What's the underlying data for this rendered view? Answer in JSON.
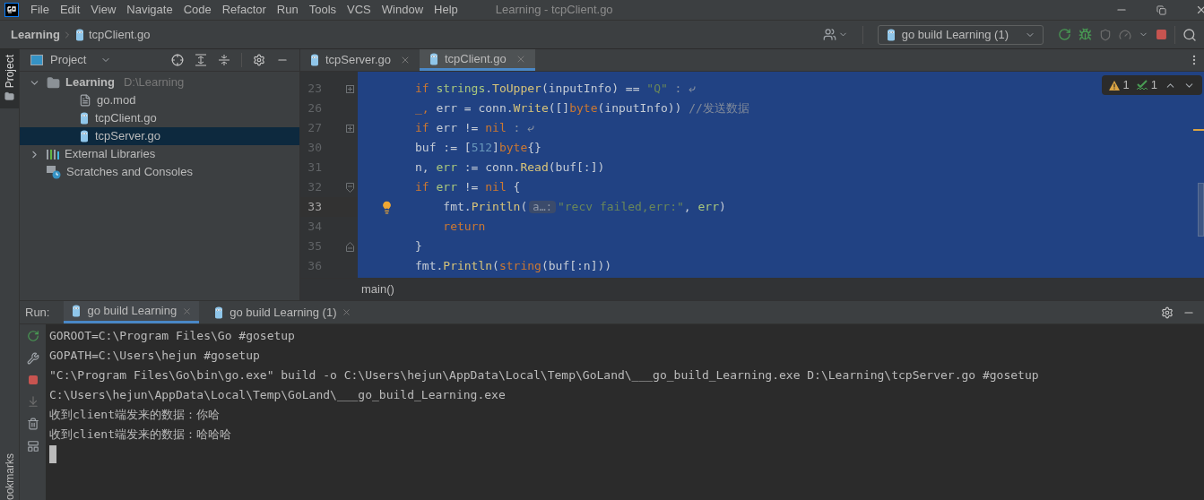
{
  "menu": [
    "File",
    "Edit",
    "View",
    "Navigate",
    "Code",
    "Refactor",
    "Run",
    "Tools",
    "VCS",
    "Window",
    "Help"
  ],
  "window": {
    "title": "Learning - tcpClient.go"
  },
  "breadcrumb": [
    "Learning",
    "tcpClient.go"
  ],
  "run_config": {
    "label": "go build Learning (1)"
  },
  "side_tabs": {
    "top": "Project",
    "bottom": "ookmarks"
  },
  "project": {
    "title": "Project",
    "tree": [
      {
        "label": "Learning",
        "path": "D:\\Learning",
        "kind": "folder",
        "expanded": true,
        "selected": false,
        "children": [
          {
            "label": "go.mod",
            "kind": "text",
            "selected": false
          },
          {
            "label": "tcpClient.go",
            "kind": "go",
            "selected": false
          },
          {
            "label": "tcpServer.go",
            "kind": "go",
            "selected": true
          }
        ]
      },
      {
        "label": "External Libraries",
        "kind": "library",
        "expanded": false,
        "selected": false
      },
      {
        "label": "Scratches and Consoles",
        "kind": "scratch",
        "selected": false
      }
    ]
  },
  "editor_tabs": [
    {
      "label": "tcpServer.go",
      "selected": false
    },
    {
      "label": "tcpClient.go",
      "selected": true
    }
  ],
  "inspections": {
    "warnings": "1",
    "typos": "1"
  },
  "code": [
    {
      "number": "23",
      "kind": "collapsed",
      "current": false,
      "tokens": [
        {
          "text": "if ",
          "kind": "keyword"
        },
        {
          "text": "strings",
          "kind": "ident"
        },
        {
          "text": ".",
          "kind": "plain"
        },
        {
          "text": "ToUpper",
          "kind": "function"
        },
        {
          "text": "(inputInfo) == ",
          "kind": "plain"
        },
        {
          "text": "\"Q\"",
          "kind": "string"
        },
        {
          "text": " : ⤶",
          "kind": "folded"
        }
      ]
    },
    {
      "number": "26",
      "kind": "plain",
      "current": false,
      "tokens": [
        {
          "text": "_, ",
          "kind": "keyword"
        },
        {
          "text": "err = conn.",
          "kind": "plain"
        },
        {
          "text": "Write",
          "kind": "function"
        },
        {
          "text": "([]",
          "kind": "plain"
        },
        {
          "text": "byte",
          "kind": "keyword"
        },
        {
          "text": "(inputInfo)) ",
          "kind": "plain"
        },
        {
          "text": "//发送数据",
          "kind": "comment"
        }
      ]
    },
    {
      "number": "27",
      "kind": "collapsed",
      "current": false,
      "tokens": [
        {
          "text": "if ",
          "kind": "keyword"
        },
        {
          "text": "err != ",
          "kind": "plain"
        },
        {
          "text": "nil",
          "kind": "keyword"
        },
        {
          "text": " : ⤶",
          "kind": "folded"
        }
      ]
    },
    {
      "number": "30",
      "kind": "plain",
      "current": false,
      "tokens": [
        {
          "text": "buf := [",
          "kind": "plain"
        },
        {
          "text": "512",
          "kind": "number"
        },
        {
          "text": "]",
          "kind": "plain"
        },
        {
          "text": "byte",
          "kind": "keyword"
        },
        {
          "text": "{}",
          "kind": "plain"
        }
      ]
    },
    {
      "number": "31",
      "kind": "plain",
      "current": false,
      "tokens": [
        {
          "text": "n, ",
          "kind": "plain"
        },
        {
          "text": "err",
          "kind": "ident"
        },
        {
          "text": " := conn.",
          "kind": "plain"
        },
        {
          "text": "Read",
          "kind": "function"
        },
        {
          "text": "(buf[:])",
          "kind": "plain"
        }
      ]
    },
    {
      "number": "32",
      "kind": "fold_start",
      "current": false,
      "tokens": [
        {
          "text": "if ",
          "kind": "keyword"
        },
        {
          "text": "err",
          "kind": "ident"
        },
        {
          "text": " != ",
          "kind": "plain"
        },
        {
          "text": "nil",
          "kind": "keyword"
        },
        {
          "text": " {",
          "kind": "plain"
        }
      ]
    },
    {
      "number": "33",
      "kind": "plain",
      "current": true,
      "tokens": [
        {
          "text": "    fmt.",
          "kind": "plain"
        },
        {
          "text": "Println",
          "kind": "function"
        },
        {
          "text": "(",
          "kind": "plain"
        },
        {
          "text": "a…:",
          "kind": "hint"
        },
        {
          "text": "\"recv failed,err:\"",
          "kind": "string"
        },
        {
          "text": ", ",
          "kind": "plain"
        },
        {
          "text": "err",
          "kind": "ident"
        },
        {
          "text": ")",
          "kind": "plain"
        }
      ]
    },
    {
      "number": "34",
      "kind": "plain",
      "current": false,
      "tokens": [
        {
          "text": "    return",
          "kind": "keyword"
        }
      ]
    },
    {
      "number": "35",
      "kind": "fold_end",
      "current": false,
      "tokens": [
        {
          "text": "}",
          "kind": "plain"
        }
      ]
    },
    {
      "number": "36",
      "kind": "plain",
      "current": false,
      "tokens": [
        {
          "text": "fmt.",
          "kind": "plain"
        },
        {
          "text": "Println",
          "kind": "function"
        },
        {
          "text": "(",
          "kind": "plain"
        },
        {
          "text": "string",
          "kind": "keyword"
        },
        {
          "text": "(buf[:n]))",
          "kind": "plain"
        }
      ]
    }
  ],
  "editor_breadcrumb": "main()",
  "run": {
    "label": "Run:",
    "tabs": [
      {
        "label": "go build Learning",
        "selected": true
      },
      {
        "label": "go build Learning (1)",
        "selected": false
      }
    ],
    "console": [
      "GOROOT=C:\\Program Files\\Go #gosetup",
      "GOPATH=C:\\Users\\hejun #gosetup",
      "\"C:\\Program Files\\Go\\bin\\go.exe\" build -o C:\\Users\\hejun\\AppData\\Local\\Temp\\GoLand\\___go_build_Learning.exe D:\\Learning\\tcpServer.go #gosetup",
      "C:\\Users\\hejun\\AppData\\Local\\Temp\\GoLand\\___go_build_Learning.exe",
      "收到client端发来的数据：你哈",
      "收到client端发来的数据：哈哈哈"
    ]
  }
}
